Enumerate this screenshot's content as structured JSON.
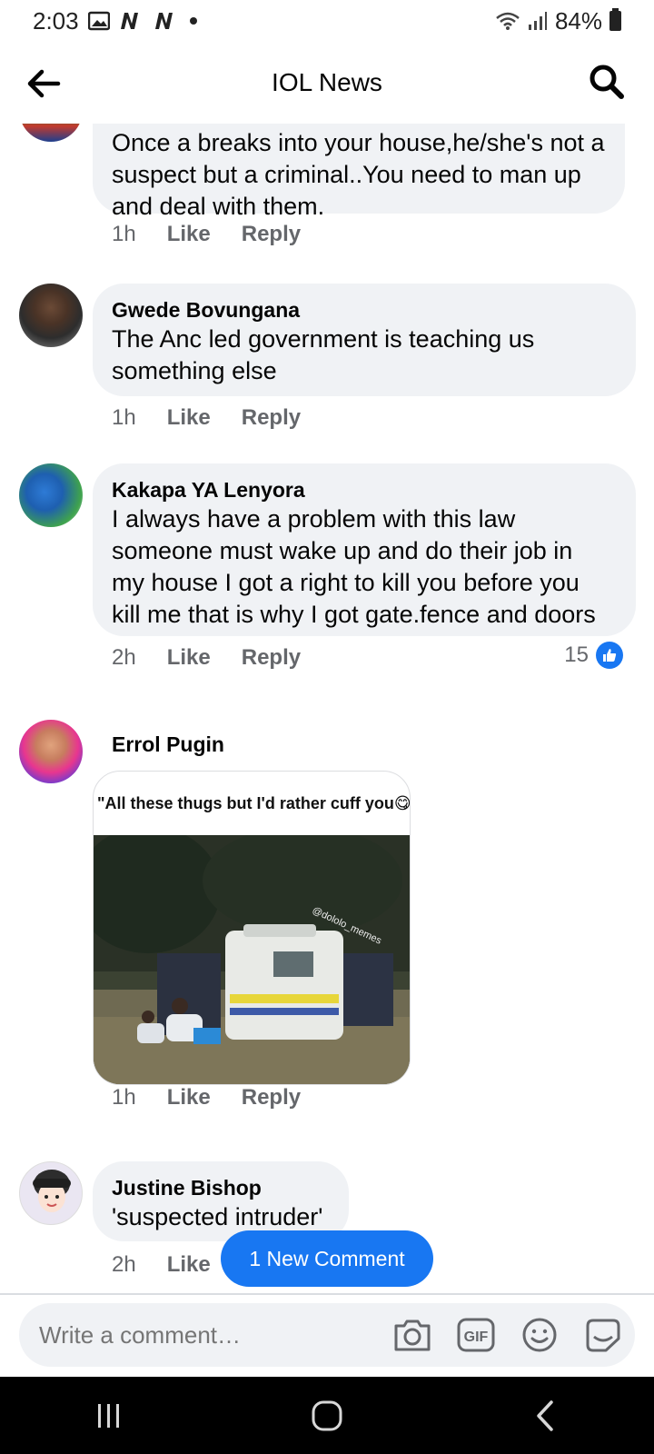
{
  "status_bar": {
    "time": "2:03",
    "battery": "84%"
  },
  "header": {
    "title": "IOL News"
  },
  "comments": [
    {
      "author": "",
      "text_lines": [
        "Once a breaks into your house,he/she's not a",
        "suspect but a criminal..You need to man up",
        "and deal with them."
      ],
      "time": "1h",
      "like_label": "Like",
      "reply_label": "Reply"
    },
    {
      "author": "Gwede Bovungana",
      "text_lines": [
        "The Anc led government is teaching us",
        "something else"
      ],
      "time": "1h",
      "like_label": "Like",
      "reply_label": "Reply"
    },
    {
      "author": "Kakapa YA Lenyora",
      "text_lines": [
        "I always have a problem with this law",
        "someone must wake up and do their job in",
        "my house I got a right to kill you before you",
        "kill me that is why I got gate.fence and doors"
      ],
      "time": "2h",
      "like_label": "Like",
      "reply_label": "Reply",
      "reaction_count": "15"
    },
    {
      "author": "Errol Pugin",
      "meme": {
        "caption": "\"All these thugs but I'd rather cuff you😋\"",
        "watermark": "@dololo_memes"
      },
      "time": "1h",
      "like_label": "Like",
      "reply_label": "Reply"
    },
    {
      "author": "Justine Bishop",
      "text_lines": [
        "'suspected intruder'"
      ],
      "time": "2h",
      "like_label": "Like"
    }
  ],
  "new_comment_pill": "1 New Comment",
  "composer": {
    "placeholder": "Write a comment…"
  },
  "colors": {
    "accent": "#1877f2",
    "bubble": "#f0f2f5",
    "meta": "#65676b"
  }
}
